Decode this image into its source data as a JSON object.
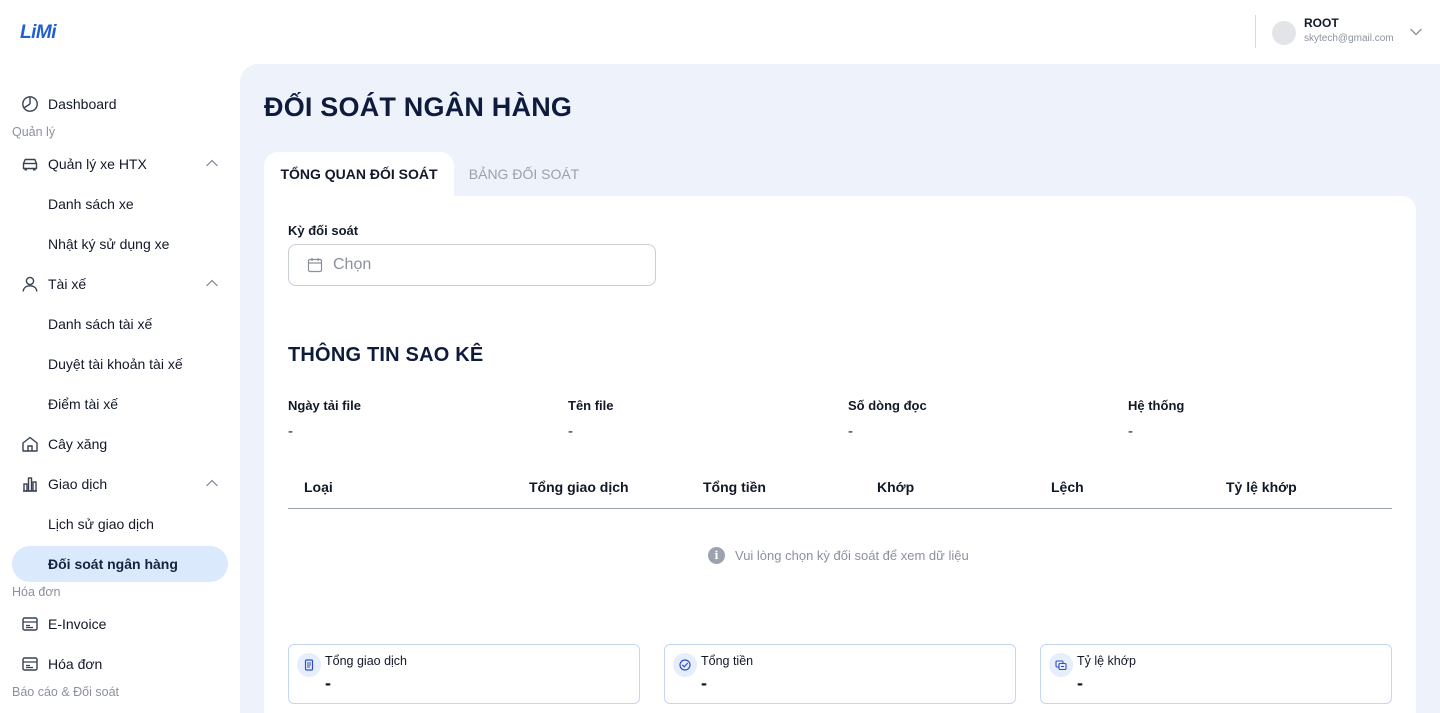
{
  "header": {
    "logo": "LiMi",
    "user_name": "ROOT",
    "user_email": "skytech@gmail.com"
  },
  "sidebar": {
    "dashboard": "Dashboard",
    "section_manage": "Quản lý",
    "vehicles": "Quản lý xe HTX",
    "vehicle_list": "Danh sách xe",
    "vehicle_log": "Nhật ký sử dụng xe",
    "drivers": "Tài xế",
    "driver_list": "Danh sách tài xế",
    "driver_approve": "Duyệt tài khoản tài xế",
    "driver_points": "Điểm tài xế",
    "gas_station": "Cây xăng",
    "transactions": "Giao dịch",
    "transaction_history": "Lịch sử giao dịch",
    "bank_reconcile": "Đối soát ngân hàng",
    "section_invoice": "Hóa đơn",
    "einvoice": "E-Invoice",
    "invoice": "Hóa đơn",
    "section_report": "Báo cáo & Đối soát"
  },
  "main": {
    "title": "ĐỐI SOÁT NGÂN HÀNG",
    "tabs": [
      {
        "label": "TỔNG QUAN ĐỐI SOÁT"
      },
      {
        "label": "BẢNG ĐỐI SOÁT"
      }
    ],
    "period_label": "Kỳ đối soát",
    "period_placeholder": "Chọn",
    "statement_title": "THÔNG TIN SAO KÊ",
    "info": [
      {
        "label": "Ngày tải file",
        "value": "-"
      },
      {
        "label": "Tên file",
        "value": "-"
      },
      {
        "label": "Số dòng đọc",
        "value": "-"
      },
      {
        "label": "Hệ thống",
        "value": "-"
      }
    ],
    "table_headers": [
      "Loại",
      "Tổng giao dịch",
      "Tổng tiền",
      "Khớp",
      "Lệch",
      "Tỷ lệ khớp"
    ],
    "empty_message": "Vui lòng chọn kỳ đối soát để xem dữ liệu",
    "stats": [
      {
        "label": "Tổng giao dịch",
        "value": "-",
        "icon": "document-icon"
      },
      {
        "label": "Tổng tiền",
        "value": "-",
        "icon": "check-circle-icon"
      },
      {
        "label": "Tỷ lệ khớp",
        "value": "-",
        "icon": "sync-icon"
      }
    ]
  }
}
